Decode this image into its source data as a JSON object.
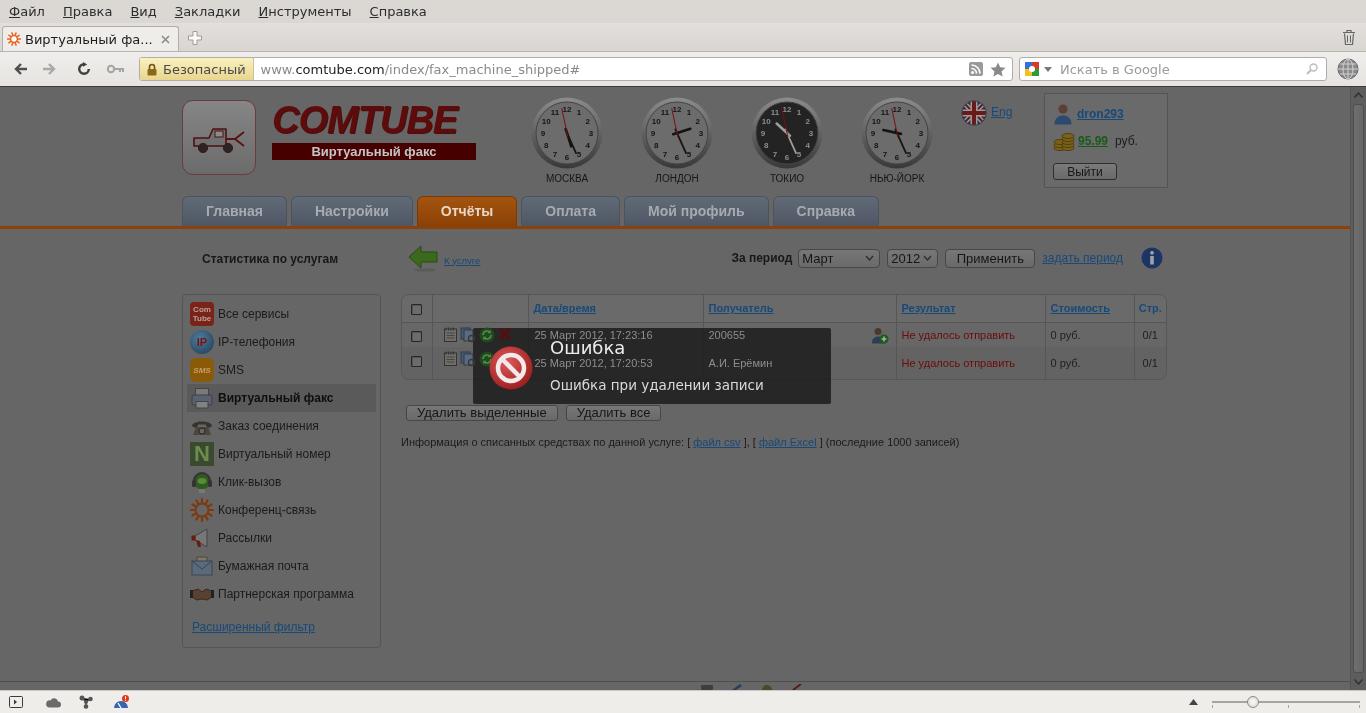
{
  "menu_bar": {
    "items": [
      "Файл",
      "Правка",
      "Вид",
      "Закладки",
      "Инструменты",
      "Справка"
    ]
  },
  "browser_tabs": [
    {
      "title": "Виртуальный фа...",
      "selected": true
    }
  ],
  "address_bar": {
    "security_label": "Безопасный",
    "url_parts": [
      {
        "text": "www.",
        "emphasis": false
      },
      {
        "text": "comtube.com",
        "emphasis": true
      },
      {
        "text": "/index/fax_machine_shipped#",
        "emphasis": false
      }
    ]
  },
  "search": {
    "placeholder": "Искать в Google"
  },
  "site_header": {
    "logo_text": "COMTUBE",
    "logo_subtitle": "Виртуальный факс",
    "clocks": [
      {
        "city": "МОСКВА",
        "kind": "day",
        "dial": [
          "11",
          "12",
          "1",
          "10",
          "2",
          "9",
          "3",
          "8",
          "4",
          "7",
          "6",
          "5"
        ]
      },
      {
        "city": "ЛОНДОН",
        "kind": "day",
        "dial": [
          "11",
          "12",
          "1",
          "10",
          "2",
          "9",
          "3",
          "8",
          "4",
          "7",
          "6",
          "5"
        ]
      },
      {
        "city": "ТОКИО",
        "kind": "night",
        "dial": [
          "11",
          "12",
          "1",
          "10",
          "2",
          "9",
          "3",
          "8",
          "4",
          "7",
          "6",
          "5"
        ]
      },
      {
        "city": "НЬЮ-ЙОРК",
        "kind": "day",
        "dial": [
          "11",
          "12",
          "1",
          "10",
          "2",
          "9",
          "3",
          "8",
          "4",
          "7",
          "6",
          "5"
        ]
      }
    ],
    "language": {
      "label": "Eng"
    },
    "account": {
      "username": "dron293",
      "balance": "95.99",
      "currency": "руб.",
      "logout": "Выйти"
    }
  },
  "nav_tabs": [
    {
      "label": "Главная",
      "selected": false
    },
    {
      "label": "Настройки",
      "selected": false
    },
    {
      "label": "Отчёты",
      "selected": true
    },
    {
      "label": "Оплата",
      "selected": false
    },
    {
      "label": "Мой профиль",
      "selected": false
    },
    {
      "label": "Справка",
      "selected": false
    }
  ],
  "toolbar": {
    "heading": "Статистика по услугам",
    "back_link": "К услуге",
    "period_label": "За период",
    "month": "Март",
    "year": "2012",
    "apply": "Применить",
    "custom_period": "задать период"
  },
  "sidebar": {
    "items": [
      {
        "label": "Все сервисы",
        "selected": false,
        "icon_text": "Com Tube"
      },
      {
        "label": "IP-телефония",
        "selected": false,
        "icon_text": "IP"
      },
      {
        "label": "SMS",
        "selected": false,
        "icon_text": "SMS"
      },
      {
        "label": "Виртуальный факс",
        "selected": true
      },
      {
        "label": "Заказ соединения",
        "selected": false
      },
      {
        "label": "Виртуальный номер",
        "selected": false,
        "icon_text": "N"
      },
      {
        "label": "Клик-вызов",
        "selected": false
      },
      {
        "label": "Конференц-связь",
        "selected": false
      },
      {
        "label": "Рассылки",
        "selected": false
      },
      {
        "label": "Бумажная почта",
        "selected": false
      },
      {
        "label": "Партнерская программа",
        "selected": false
      }
    ],
    "filter_link": "Расширенный фильтр"
  },
  "table": {
    "columns": [
      {
        "kind": "checkbox",
        "checked": false
      },
      {
        "kind": "blank"
      },
      {
        "kind": "sort_link",
        "label": "Дата/время"
      },
      {
        "kind": "sort_link",
        "label": "Получатель"
      },
      {
        "kind": "sort_link",
        "label": "Результат"
      },
      {
        "kind": "sort_link",
        "label": "Стоимость"
      },
      {
        "kind": "plain",
        "label": "Стр."
      }
    ],
    "rows": [
      {
        "checked": false,
        "datetime": "25 Март 2012, 17:23:16",
        "recipient": "200655",
        "add_contact": true,
        "result": "Не удалось отправить",
        "cost": "0 руб.",
        "pages": "0/1"
      },
      {
        "checked": false,
        "datetime": "25 Март 2012, 17:20:53",
        "recipient": "А.И. Ерёмин",
        "add_contact": false,
        "result": "Не удалось отправить",
        "cost": "0 руб.",
        "pages": "0/1"
      }
    ]
  },
  "actions": [
    "Удалить выделенные",
    "Удалить все"
  ],
  "info": {
    "parts": [
      {
        "kind": "text",
        "text": "Информация о списанных средствах по данной услуге: [ "
      },
      {
        "kind": "link",
        "text": "файл csv"
      },
      {
        "kind": "text",
        "text": " ], [ "
      },
      {
        "kind": "link",
        "text": "файл Excel"
      },
      {
        "kind": "text",
        "text": " ] (последние 1000 записей)"
      }
    ]
  },
  "notification": {
    "title": "Ошибка",
    "message": "Ошибка при удалении записи"
  },
  "status_bar": {
    "zoom": {
      "level": 0.28
    }
  }
}
